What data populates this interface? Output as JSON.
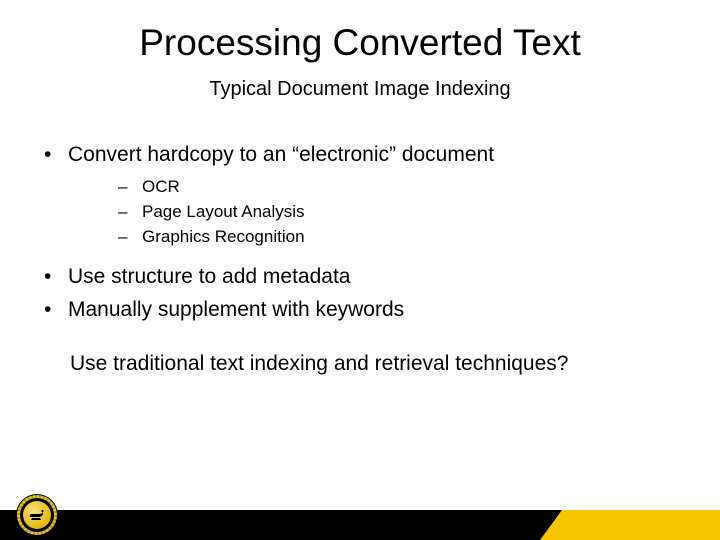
{
  "title": "Processing Converted Text",
  "subtitle": "Typical Document Image Indexing",
  "bullets": {
    "b0": {
      "text": "Convert hardcopy to an “electronic” document",
      "sub": [
        "OCR",
        "Page Layout Analysis",
        "Graphics Recognition"
      ]
    },
    "b1": {
      "text": "Use structure to add metadata"
    },
    "b2": {
      "text": "Manually supplement with keywords"
    }
  },
  "closing": "Use traditional text indexing and retrieval techniques?",
  "colors": {
    "accent": "#f3c400",
    "bar": "#000000"
  },
  "icons": {
    "badge": "lamp-seal-icon"
  }
}
